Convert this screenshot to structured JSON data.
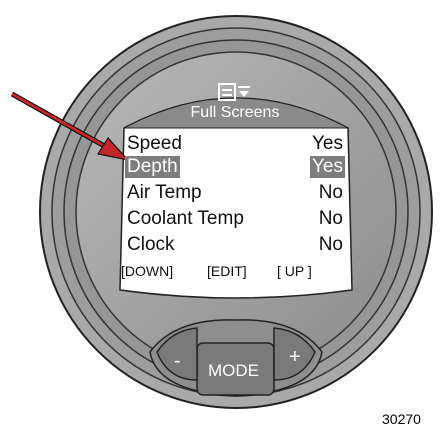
{
  "screen": {
    "title": "Full Screens",
    "icon": "menu-list-icon",
    "rows": [
      {
        "label": "Speed",
        "value": "Yes",
        "selected": false
      },
      {
        "label": "Depth",
        "value": "Yes",
        "selected": true
      },
      {
        "label": "Air Temp",
        "value": "No",
        "selected": false
      },
      {
        "label": "Coolant Temp",
        "value": "No",
        "selected": false
      },
      {
        "label": "Clock",
        "value": "No",
        "selected": false
      }
    ],
    "softkeys": {
      "down": "[DOWN]",
      "edit": "[EDIT]",
      "up": "[ UP ]"
    }
  },
  "buttons": {
    "minus": "-",
    "mode": "MODE",
    "plus": "+"
  },
  "figure_number": "30270",
  "colors": {
    "bezel": "#9a9a9a",
    "screen": "#ffffff",
    "highlight": "#7d7d7d",
    "arrow": "#c0282a"
  }
}
